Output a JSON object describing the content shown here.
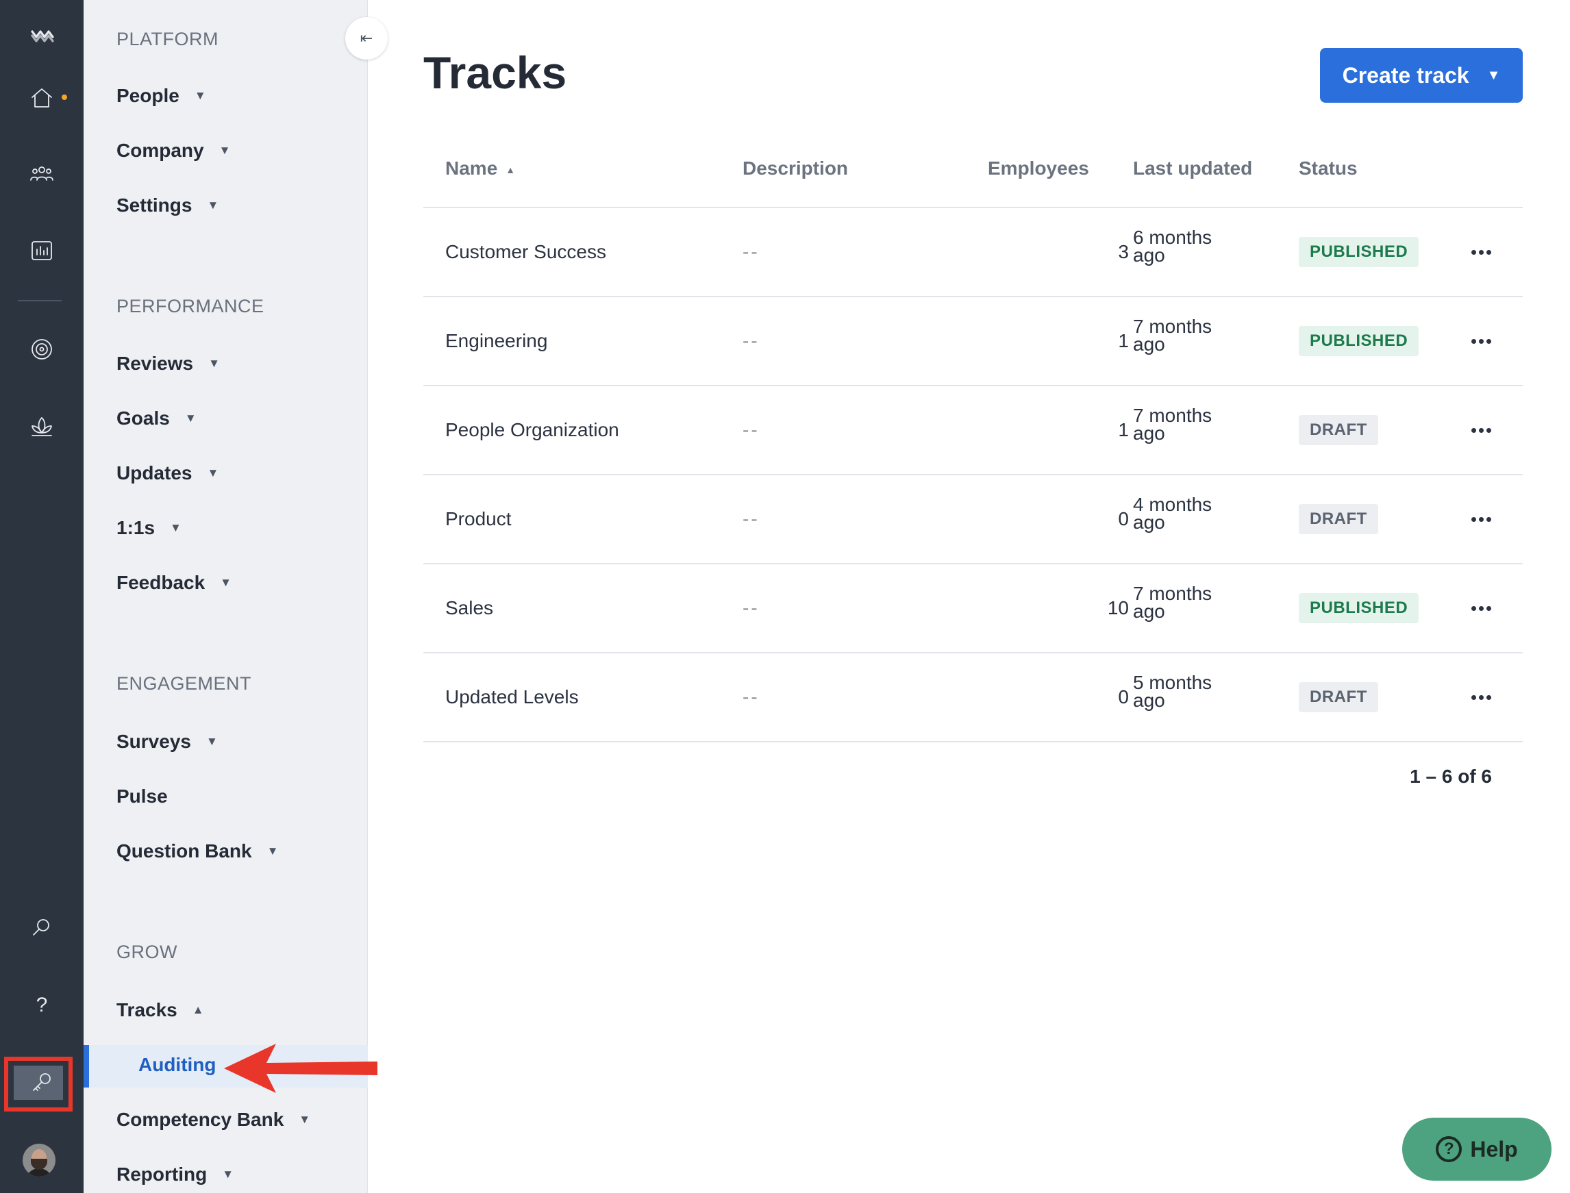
{
  "rail": {
    "icons": [
      "logo-icon",
      "home-icon",
      "people-icon",
      "chart-icon",
      "target-icon",
      "lotus-icon",
      "search-icon",
      "help-icon",
      "key-icon",
      "avatar"
    ],
    "notification_color": "#f5a623",
    "help_glyph": "?"
  },
  "sidebar": {
    "collapse_glyph": "⇤",
    "sections": {
      "platform": "PLATFORM",
      "performance": "PERFORMANCE",
      "engagement": "ENGAGEMENT",
      "grow": "GROW"
    },
    "items": {
      "people": "People",
      "company": "Company",
      "settings": "Settings",
      "reviews": "Reviews",
      "goals": "Goals",
      "updates": "Updates",
      "one_on_ones": "1:1s",
      "feedback": "Feedback",
      "surveys": "Surveys",
      "pulse": "Pulse",
      "question_bank": "Question Bank",
      "tracks": "Tracks",
      "auditing": "Auditing",
      "competency_bank": "Competency Bank",
      "reporting": "Reporting"
    },
    "caret_down": "▼",
    "caret_up": "▲"
  },
  "main": {
    "title": "Tracks",
    "create_button": "Create track",
    "create_caret": "▼",
    "columns": {
      "name": "Name",
      "description": "Description",
      "employees": "Employees",
      "last_updated": "Last updated",
      "status": "Status"
    },
    "sort_glyph": "▲",
    "rows": [
      {
        "name": "Customer Success",
        "description": "--",
        "employees": "3",
        "last_updated": "6 months ago",
        "status": "PUBLISHED"
      },
      {
        "name": "Engineering",
        "description": "--",
        "employees": "1",
        "last_updated": "7 months ago",
        "status": "PUBLISHED"
      },
      {
        "name": "People Organization",
        "description": "--",
        "employees": "1",
        "last_updated": "7 months ago",
        "status": "DRAFT"
      },
      {
        "name": "Product",
        "description": "--",
        "employees": "0",
        "last_updated": "4 months ago",
        "status": "DRAFT"
      },
      {
        "name": "Sales",
        "description": "--",
        "employees": "10",
        "last_updated": "7 months ago",
        "status": "PUBLISHED"
      },
      {
        "name": "Updated Levels",
        "description": "--",
        "employees": "0",
        "last_updated": "5 months ago",
        "status": "DRAFT"
      }
    ],
    "pagination": "1 – 6 of 6"
  },
  "help_button": {
    "label": "Help",
    "glyph": "?"
  },
  "colors": {
    "rail_bg": "#2c3440",
    "accent": "#2a6fdb",
    "published": "#1d7a4c",
    "annotation": "#e8372a",
    "help_bg": "#4da37f"
  }
}
